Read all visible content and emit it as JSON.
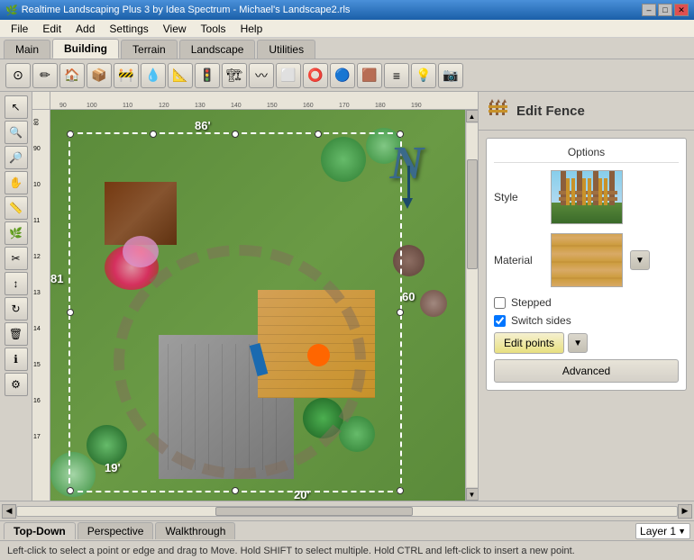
{
  "titlebar": {
    "title": "Realtime Landscaping Plus 3 by Idea Spectrum - Michael's Landscape2.rls",
    "min": "–",
    "max": "□",
    "close": "✕"
  },
  "menubar": {
    "items": [
      "File",
      "Edit",
      "Add",
      "Settings",
      "View",
      "Tools",
      "Help"
    ]
  },
  "tabs": {
    "items": [
      "Main",
      "Building",
      "Terrain",
      "Landscape",
      "Utilities"
    ],
    "active": "Building"
  },
  "toolbar": {
    "tools": [
      "🏠",
      "🔧",
      "🏡",
      "📦",
      "🌳",
      "💧",
      "📐",
      "🚧",
      "🏗",
      "📋",
      "🔲",
      "⬜",
      "🔵",
      "🔶",
      "📷"
    ]
  },
  "edit_fence": {
    "title": "Edit Fence",
    "icon": "🟫",
    "options_label": "Options",
    "style_label": "Style",
    "material_label": "Material",
    "stepped_label": "Stepped",
    "switch_sides_label": "Switch sides",
    "edit_points_label": "Edit points",
    "advanced_label": "Advanced",
    "stepped_checked": false,
    "switch_sides_checked": true
  },
  "dimensions": {
    "top": "86'",
    "right": "60",
    "bottom": "20'",
    "left": "81"
  },
  "corner_dim": "19'",
  "north_arrow": "N",
  "view_tabs": {
    "items": [
      "Top-Down",
      "Perspective",
      "Walkthrough"
    ],
    "active": "Top-Down"
  },
  "layer": {
    "label": "Layer 1",
    "arrow": "▼"
  },
  "statusbar": {
    "text": "Left-click to select a point or edge and drag to Move. Hold SHIFT to select multiple. Hold CTRL and left-click to insert a new point."
  }
}
